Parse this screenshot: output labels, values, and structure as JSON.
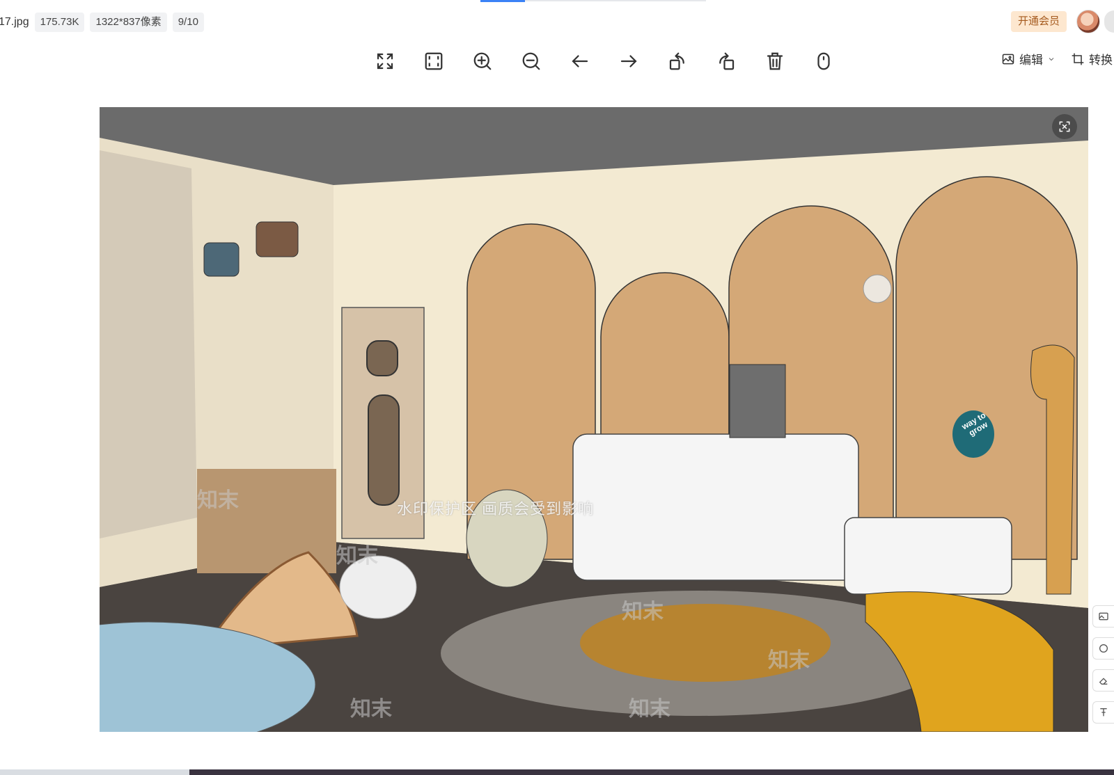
{
  "file": {
    "name": "17.jpg",
    "size": "175.73K",
    "dimensions": "1322*837像素",
    "index": "9/10"
  },
  "header": {
    "vip_label": "开通会员",
    "edit_label": "编辑",
    "convert_label": "转换"
  },
  "toolbar": {
    "items": [
      "fullscreen",
      "fit-window",
      "zoom-in",
      "zoom-out",
      "previous",
      "next",
      "rotate-left",
      "rotate-right",
      "delete",
      "more"
    ]
  },
  "watermark": {
    "brand": "知末",
    "notice": "水印保护区  画质会受到影响"
  },
  "scene_text": {
    "sign": "way to grow"
  },
  "colors": {
    "vip_bg": "#fde7cf",
    "vip_text": "#a55a1e",
    "accent": "#3b82f6"
  }
}
